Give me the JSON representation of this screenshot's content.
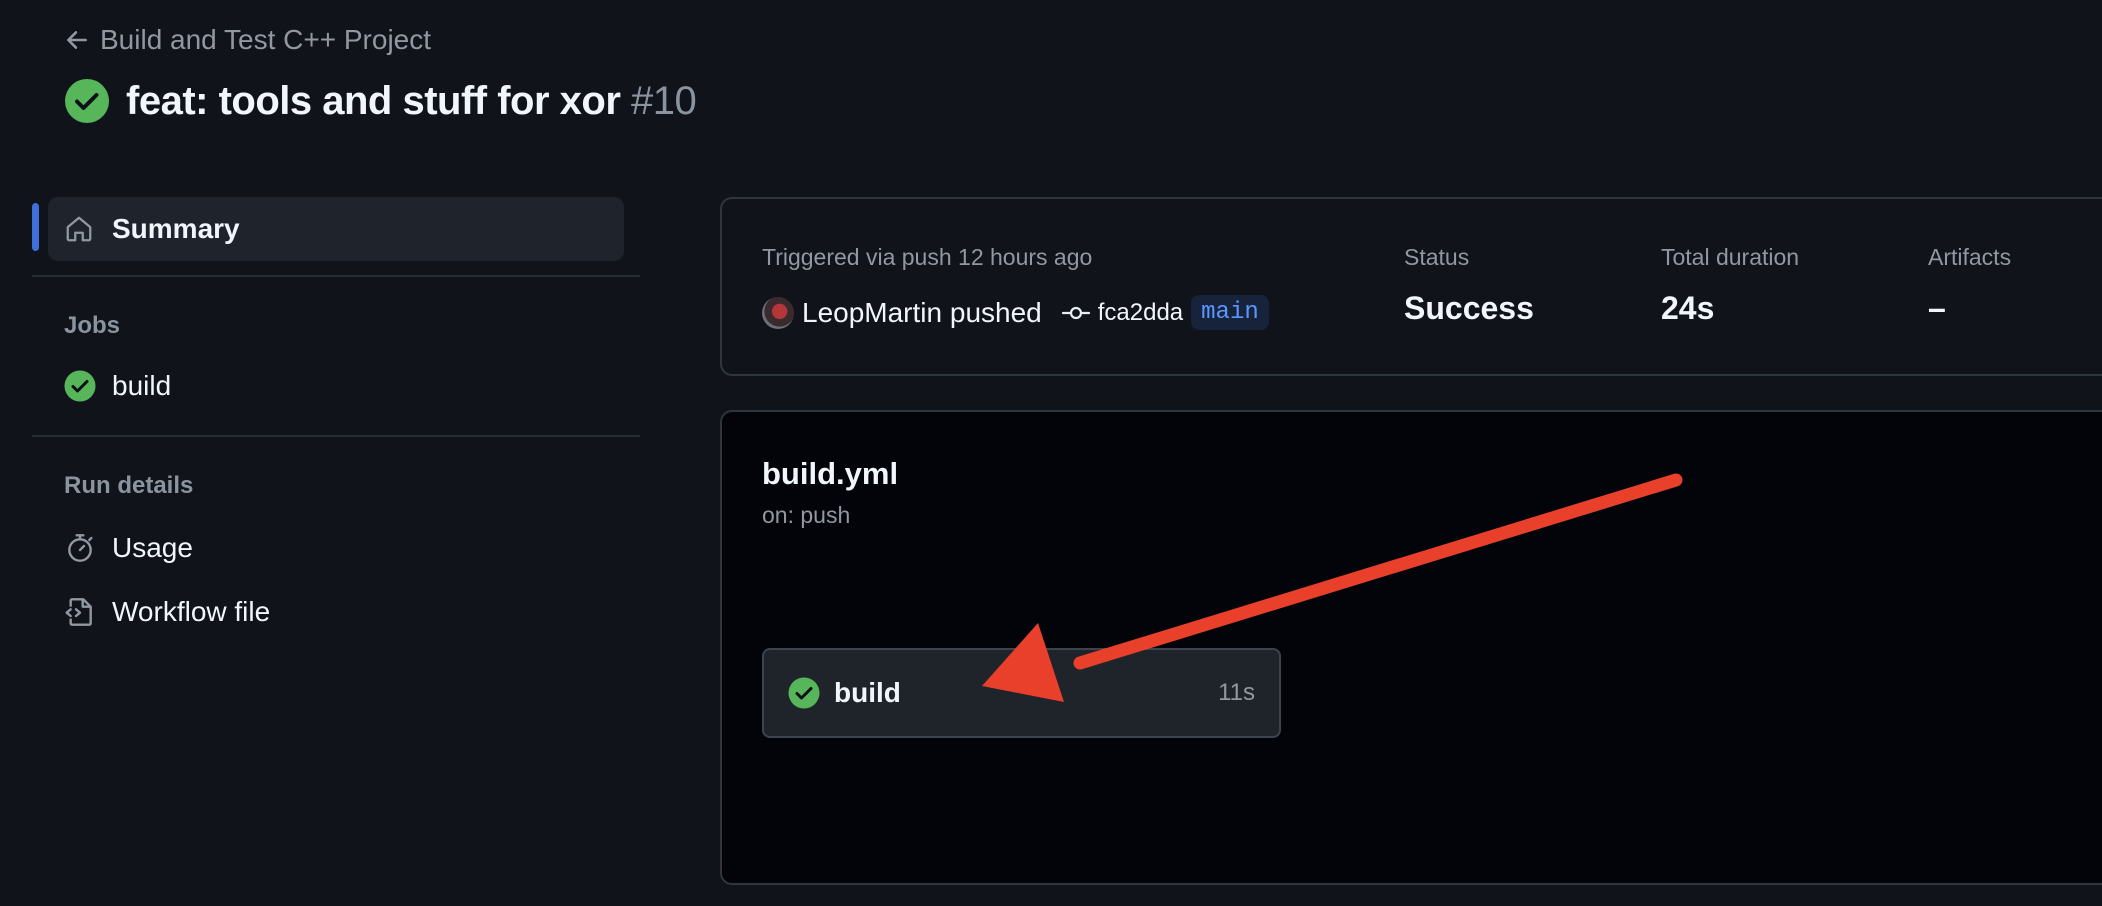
{
  "header": {
    "back_label": "Build and Test C++ Project",
    "run_title": "feat: tools and stuff for xor",
    "run_number": "#10"
  },
  "sidebar": {
    "summary_label": "Summary",
    "jobs_heading": "Jobs",
    "jobs": [
      {
        "label": "build",
        "status": "success"
      }
    ],
    "run_details_heading": "Run details",
    "usage_label": "Usage",
    "workflow_file_label": "Workflow file"
  },
  "run_info": {
    "triggered_text": "Triggered via push 12 hours ago",
    "actor": "LeopMartin",
    "action": "pushed",
    "commit": "fca2dda",
    "branch": "main",
    "status_label": "Status",
    "status_value": "Success",
    "duration_label": "Total duration",
    "duration_value": "24s",
    "artifacts_label": "Artifacts",
    "artifacts_value": "–"
  },
  "workflow": {
    "file": "build.yml",
    "trigger": "on: push",
    "job": {
      "name": "build",
      "duration": "11s"
    }
  },
  "icons": [
    "arrow-left-icon",
    "check-circle-icon",
    "home-icon",
    "stopwatch-icon",
    "file-code-icon",
    "git-commit-icon",
    "annotation-arrow"
  ],
  "colors": {
    "background": "#10141a",
    "graph_background": "#02040a",
    "success": "#57b65a",
    "accent": "#3f6fd8",
    "branch_text": "#5b96ff",
    "annotation_arrow": "#e8402b"
  }
}
